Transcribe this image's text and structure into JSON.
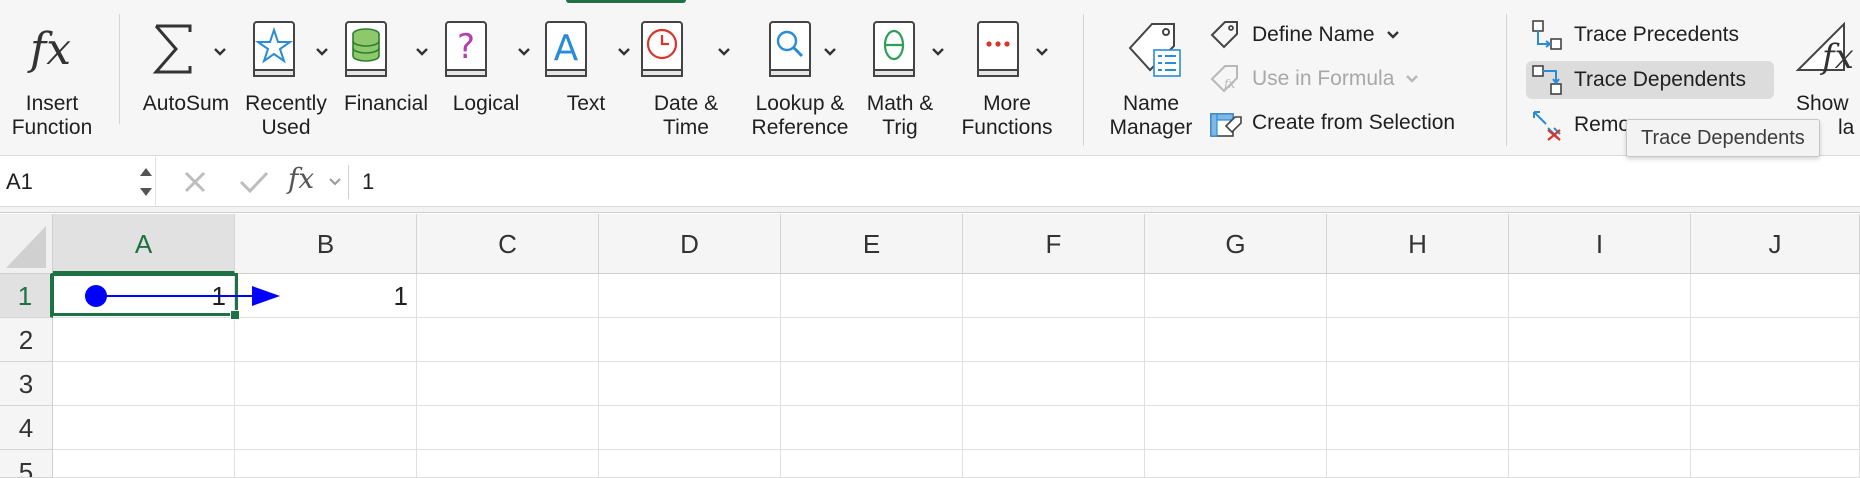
{
  "ribbon": {
    "buttons": [
      {
        "label": "Insert\nFunction",
        "icon": "fx-icon"
      },
      {
        "label": "AutoSum",
        "icon": "sigma-icon"
      },
      {
        "label": "Recently\nUsed",
        "icon": "star-book-icon"
      },
      {
        "label": "Financial",
        "icon": "coins-book-icon"
      },
      {
        "label": "Logical",
        "icon": "question-book-icon"
      },
      {
        "label": "Text",
        "icon": "a-book-icon"
      },
      {
        "label": "Date &\nTime",
        "icon": "clock-book-icon"
      },
      {
        "label": "Lookup &\nReference",
        "icon": "magnifier-book-icon"
      },
      {
        "label": "Math &\nTrig",
        "icon": "theta-book-icon"
      },
      {
        "label": "More\nFunctions",
        "icon": "dots-book-icon"
      },
      {
        "label": "Name\nManager",
        "icon": "tag-list-icon"
      }
    ],
    "defined_names": {
      "define_name": "Define Name",
      "use_in_formula": "Use in Formula",
      "create_from_selection": "Create from Selection"
    },
    "auditing": {
      "trace_precedents": "Trace Precedents",
      "trace_dependents": "Trace Dependents",
      "remove_arrows": "Remo",
      "show_formulas_top": "Show",
      "show_formulas_bottom": "la"
    },
    "tooltip": "Trace Dependents",
    "accent_color": "#1e7145"
  },
  "formula_bar": {
    "name_box": "A1",
    "content": "1"
  },
  "grid": {
    "columns": [
      "A",
      "B",
      "C",
      "D",
      "E",
      "F",
      "G",
      "H",
      "I",
      "J"
    ],
    "rows": [
      "1",
      "2",
      "3",
      "4",
      "5"
    ],
    "selected_column": "A",
    "selected_row": "1",
    "cells": {
      "A1": "1",
      "B1": "1"
    },
    "trace_arrow_color": "#0000ff"
  }
}
